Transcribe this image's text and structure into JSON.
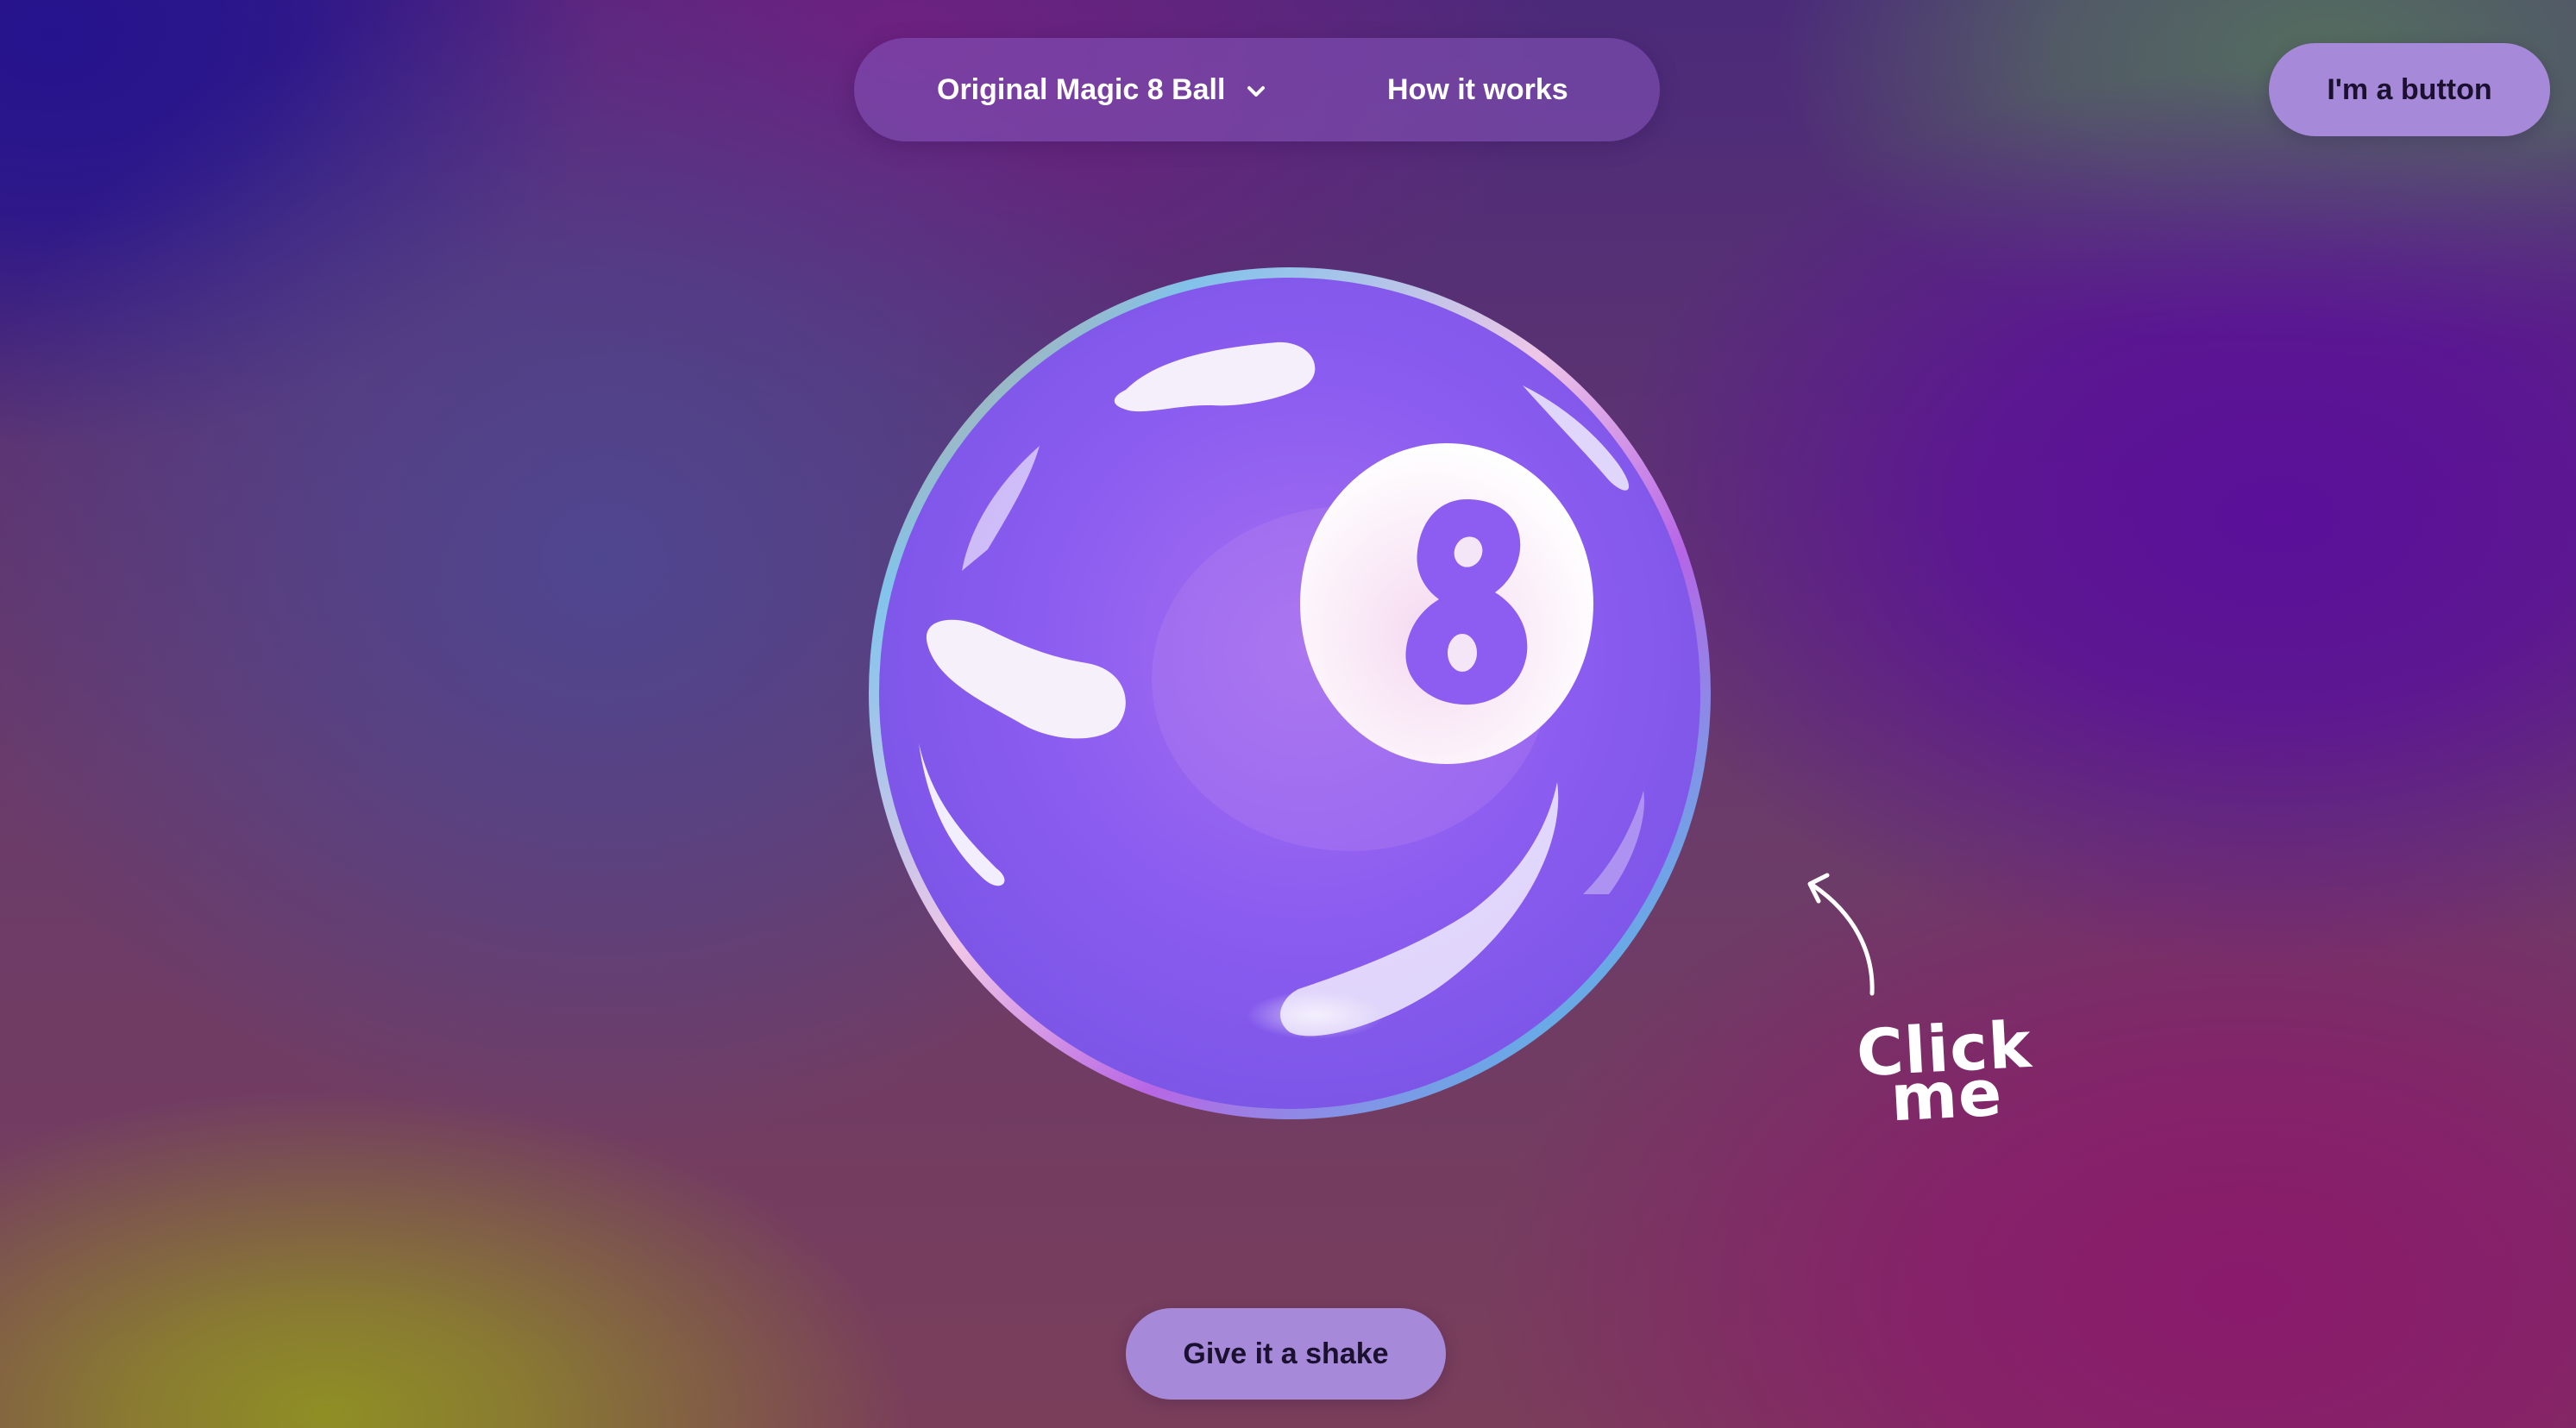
{
  "nav": {
    "versions_label": "Original Magic 8 Ball",
    "versions_icon": "chevron-down-icon",
    "how_label": "How it works"
  },
  "top_button": {
    "label": "I'm a button"
  },
  "ball": {
    "number": "8",
    "colors": {
      "body": "#8b5cf0",
      "window": "#f7eef8",
      "highlight": "#ffffff"
    }
  },
  "annotation": {
    "line1": "Click",
    "line2": "me",
    "icon": "curved-arrow-icon"
  },
  "shake_button": {
    "label": "Give it a shake"
  }
}
